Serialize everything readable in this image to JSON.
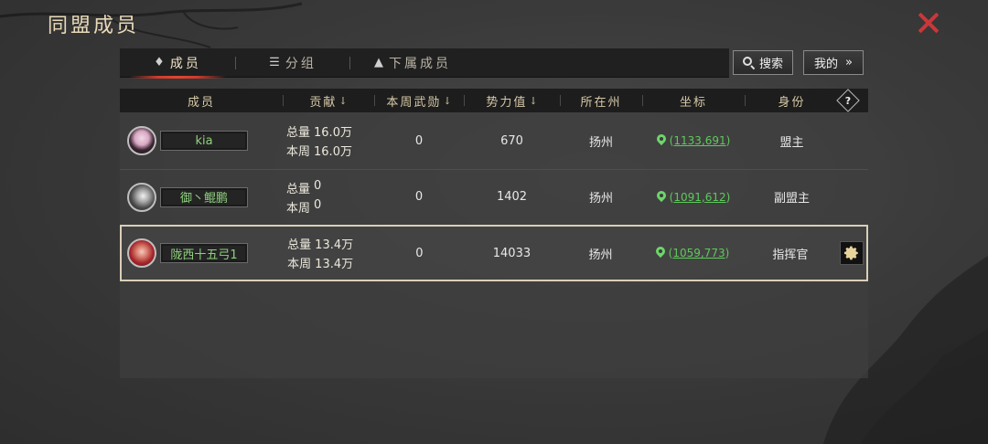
{
  "title": "同盟成员",
  "tabs": [
    {
      "label": "成员",
      "icon": "member-icon",
      "active": true
    },
    {
      "label": "分组",
      "icon": "list-icon",
      "active": false
    },
    {
      "label": "下属成员",
      "icon": "tower-icon",
      "active": false
    }
  ],
  "search_label": "搜索",
  "mine_label": "我的",
  "mine_arrow": "»",
  "columns": {
    "member": "成员",
    "contribution": "贡献",
    "weekly_merit": "本周武勋",
    "power": "势力值",
    "state": "所在州",
    "coord": "坐标",
    "role": "身份"
  },
  "sort_arrow": "↓",
  "help_icon_label": "?",
  "contrib_labels": {
    "total": "总量",
    "week": "本周"
  },
  "members": [
    {
      "name": "kia",
      "total": "16.0万",
      "week": "16.0万",
      "merit": "0",
      "power": "670",
      "state": "扬州",
      "coord_open": "(",
      "coord": "1133,691",
      "coord_close": ")",
      "role": "盟主",
      "selected": false
    },
    {
      "name": "御丶鲲鹏",
      "total": "0",
      "week": "0",
      "merit": "0",
      "power": "1402",
      "state": "扬州",
      "coord_open": "(",
      "coord": "1091,612",
      "coord_close": ")",
      "role": "副盟主",
      "selected": false
    },
    {
      "name": "陇西十五弓1",
      "total": "13.4万",
      "week": "13.4万",
      "merit": "0",
      "power": "14033",
      "state": "扬州",
      "coord_open": "(",
      "coord": "1059,773",
      "coord_close": ")",
      "role": "指挥官",
      "selected": true
    }
  ],
  "colors": {
    "accent_red": "#c8383a",
    "name_green": "#8fd17e",
    "coord_green": "#5ec95b",
    "header_gold": "#d7c9a8"
  }
}
